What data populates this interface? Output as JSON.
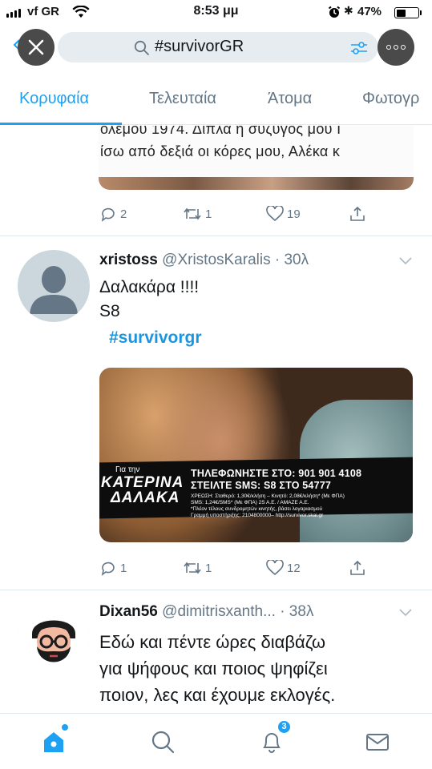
{
  "status_bar": {
    "carrier": "vf GR",
    "time": "8:53 μμ",
    "battery": "47%",
    "battery_level": 0.47
  },
  "search": {
    "query": "#survivorGR",
    "close_icon": "close-icon",
    "filter_icon": "filter-sliders-icon",
    "more_icon": "more-dots-icon"
  },
  "tabs": [
    {
      "label": "Κορυφαία",
      "active": true
    },
    {
      "label": "Τελευταία",
      "active": false
    },
    {
      "label": "Άτομα",
      "active": false
    },
    {
      "label": "Φωτογρ",
      "active": false
    }
  ],
  "partial_tweet": {
    "media_text_1": "ολεμου 1974. Διπλα η συζυγος μου Ι",
    "media_text_2": "ίσω από δεξιά οι κόρες μου, Αλέκα κ",
    "actions": {
      "reply": "2",
      "retweet": "1",
      "like": "19"
    }
  },
  "tweet_1": {
    "name": "xristoss",
    "handle": "@XristosKaralis · 30λ",
    "lines": [
      "Δαλακάρα !!!!",
      "S8"
    ],
    "hashtag": "#survivorgr",
    "media": {
      "for_label": "Για την",
      "name_line_1": "ΚΑΤΕΡΙΝΑ",
      "name_line_2": "ΔΑΛΑΚΑ",
      "phone_line": "ΤΗΛΕΦΩΝΗΣΤΕ ΣΤΟ: 901 901 4108",
      "sms_line": "ΣΤΕΙΛΤΕ SMS: S8 ΣΤΟ 54777",
      "fine_print": [
        "ΧΡΕΩΣΗ: Σταθερό: 1,30€/κλήση – Κινητό: 2,08€/κλήση* (Με ΦΠΑ)",
        "SMS: 1,24€/SMS* (Με ΦΠΑ) 2S A.E. / AMAZE A.E.",
        "*Πλέον τέλους συνδρομητών κινητής, βάσει λογαριασμού",
        "Γραμμή υποστήριξης: 2104800000– http://survivor.skai.gr"
      ]
    },
    "actions": {
      "reply": "1",
      "retweet": "1",
      "like": "12"
    }
  },
  "tweet_2": {
    "name": "Dixan56",
    "handle": "@dimitrisxanth... · 38λ",
    "lines": [
      "Εδώ και πέντε ώρες διαβάζω",
      "για  ψήφους και ποιος ψηφίζει",
      "ποιον, λες και έχουμε εκλογές."
    ]
  },
  "tab_bar": {
    "items": [
      "home-icon",
      "search-icon",
      "notifications-bell-icon",
      "messages-envelope-icon"
    ],
    "notifications_badge": "3",
    "accent": "#1da1f2"
  }
}
